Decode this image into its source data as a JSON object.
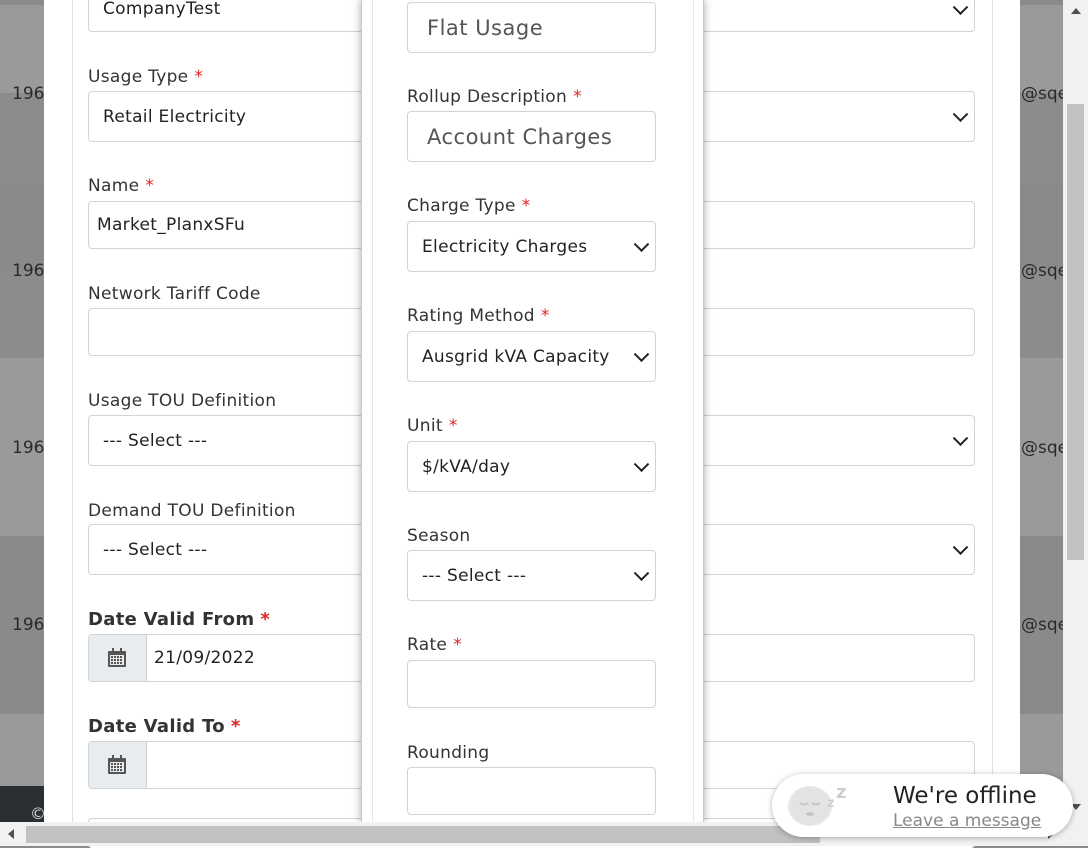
{
  "background": {
    "row_left_text": "196",
    "row_right_text": "@sqe",
    "footer_text": "©"
  },
  "outer_form": {
    "company_value": "CompanyTest",
    "usage_type_label": "Usage Type",
    "usage_type_value": "Retail Electricity",
    "name_label": "Name",
    "name_value": "Market_PlanxSFu",
    "network_tariff_label": "Network Tariff Code",
    "network_tariff_value": "",
    "usage_tou_label": "Usage TOU Definition",
    "usage_tou_value": "--- Select ---",
    "demand_tou_label": "Demand TOU Definition",
    "demand_tou_value": "--- Select ---",
    "date_from_label": "Date Valid From",
    "date_from_value": "21/09/2022",
    "date_to_label": "Date Valid To",
    "date_to_value": "",
    "required_marker": "*"
  },
  "inner_form": {
    "flat_usage_value": "Flat Usage",
    "rollup_label": "Rollup Description",
    "rollup_value": "Account Charges",
    "charge_type_label": "Charge Type",
    "charge_type_value": "Electricity Charges",
    "rating_method_label": "Rating Method",
    "rating_method_value": "Ausgrid kVA Capacity",
    "unit_label": "Unit",
    "unit_value": "$/kVA/day",
    "season_label": "Season",
    "season_value": "--- Select ---",
    "rate_label": "Rate",
    "rate_value": "",
    "rounding_label": "Rounding",
    "rounding_value": "",
    "required_marker": "*"
  },
  "chat": {
    "title": "We're offline",
    "link": "Leave a message",
    "zz": "z"
  },
  "icons": {
    "calendar": "calendar-icon",
    "chevron": "chevron-down-icon"
  }
}
